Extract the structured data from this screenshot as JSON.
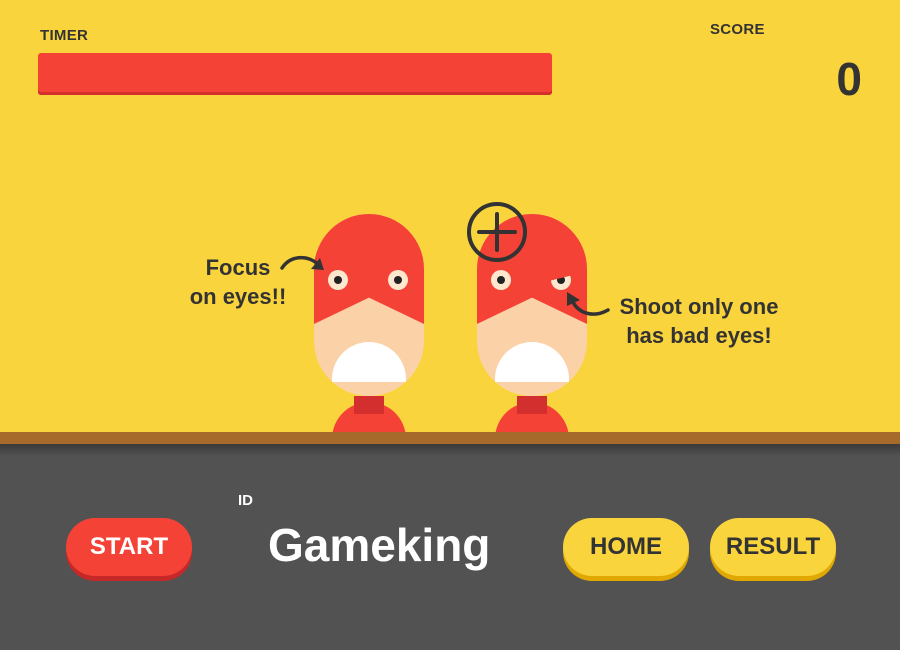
{
  "hud": {
    "timer_label": "TIMER",
    "timer_remaining": 0.86,
    "score_label": "SCORE",
    "score": "0"
  },
  "colors": {
    "stage_bg": "#FAD43C",
    "panel_bg": "#525252",
    "accent_red": "#F44336",
    "accent_yellow": "#FAD43C",
    "ledge": "#A66A2B"
  },
  "hints": {
    "left_line1": "Focus",
    "left_line2": "on eyes!!",
    "right_line1": "Shoot only one",
    "right_line2": "has bad eyes!"
  },
  "targets": [
    {
      "name": "normal-eyes"
    },
    {
      "name": "bad-eyes"
    }
  ],
  "controls": {
    "start_label": "START",
    "id_label": "ID",
    "player_id": "Gameking",
    "home_label": "HOME",
    "result_label": "RESULT"
  },
  "icons": [
    "crosshair-icon",
    "arrow-icon"
  ]
}
